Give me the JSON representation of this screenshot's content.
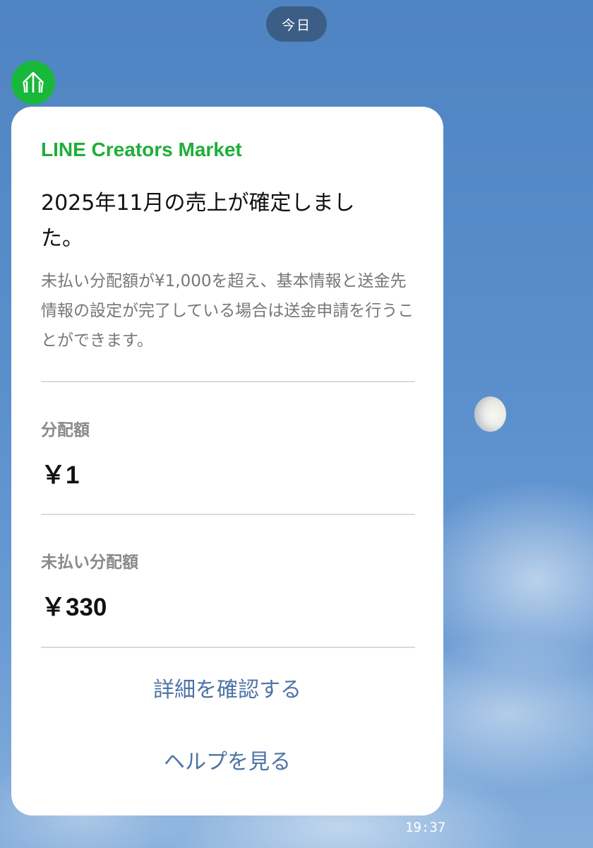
{
  "chat": {
    "date_label": "今日",
    "sent_time": "19:37"
  },
  "sender": {
    "avatar_icon": "line-creators-market-logo-icon",
    "avatar_color": "#18b83a"
  },
  "message": {
    "brand": "LINE Creators Market",
    "brand_color": "#1fae3a",
    "title": "2025年11月の売上が確定しました。",
    "description": "未払い分配額が¥1,000を超え、基本情報と送金先情報の設定が完了している場合は送金申請を行うことができます。",
    "distribution": {
      "label": "分配額",
      "value": "￥1"
    },
    "unpaid_distribution": {
      "label": "未払い分配額",
      "value": "￥330"
    },
    "actions": {
      "details": "詳細を確認する",
      "help": "ヘルプを見る"
    },
    "link_color": "#4d73a6"
  }
}
